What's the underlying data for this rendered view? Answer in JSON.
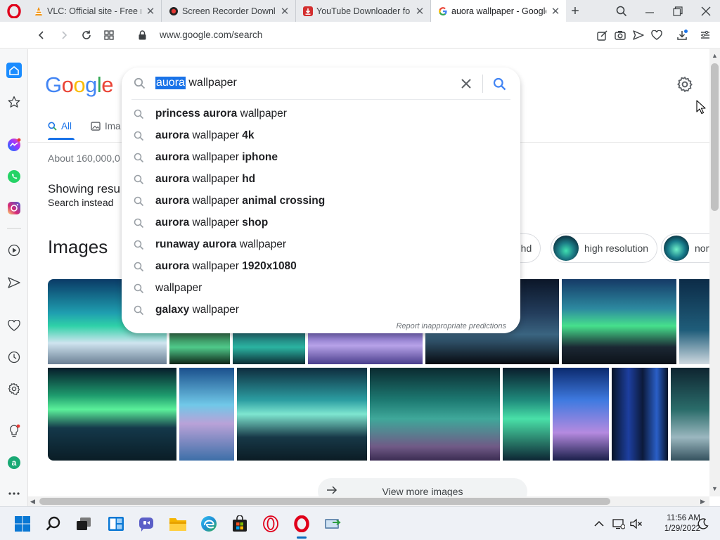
{
  "browser": {
    "tabs": [
      {
        "title": "VLC: Official site - Free m",
        "icon": "vlc-cone-icon",
        "active": false
      },
      {
        "title": "Screen Recorder Downlo",
        "icon": "record-dot-icon",
        "active": false
      },
      {
        "title": "YouTube Downloader for",
        "icon": "download-badge-icon",
        "active": false
      },
      {
        "title": "auora wallpaper - Google",
        "icon": "google-g-icon",
        "active": true
      }
    ],
    "new_tab_symbol": "+",
    "url": "www.google.com/search"
  },
  "google": {
    "logo_letters": [
      "G",
      "o",
      "o",
      "g",
      "l",
      "e"
    ],
    "logo_colors": [
      "#4285F4",
      "#EA4335",
      "#FBBC05",
      "#4285F4",
      "#34A853",
      "#EA4335"
    ],
    "tab_all": "All",
    "tab_images": "Ima",
    "stats": "About 160,000,0",
    "showing": "Showing resu",
    "search_instead": "Search instead",
    "images_heading": "Images",
    "chips": [
      {
        "label": "a hd"
      },
      {
        "label": "high resolution"
      },
      {
        "label": "nort"
      }
    ],
    "view_more": "View more images"
  },
  "search": {
    "query_selected": "auora",
    "query_rest": " wallpaper",
    "suggestions": [
      {
        "parts": [
          {
            "t": "princess aurora",
            "b": true
          },
          {
            "t": " wallpaper",
            "b": false
          }
        ]
      },
      {
        "parts": [
          {
            "t": "aurora",
            "b": true
          },
          {
            "t": " wallpaper ",
            "b": false
          },
          {
            "t": "4k",
            "b": true
          }
        ]
      },
      {
        "parts": [
          {
            "t": "aurora",
            "b": true
          },
          {
            "t": " wallpaper ",
            "b": false
          },
          {
            "t": "iphone",
            "b": true
          }
        ]
      },
      {
        "parts": [
          {
            "t": "aurora",
            "b": true
          },
          {
            "t": " wallpaper ",
            "b": false
          },
          {
            "t": "hd",
            "b": true
          }
        ]
      },
      {
        "parts": [
          {
            "t": "aurora",
            "b": true
          },
          {
            "t": " wallpaper ",
            "b": false
          },
          {
            "t": "animal crossing",
            "b": true
          }
        ]
      },
      {
        "parts": [
          {
            "t": "aurora",
            "b": true
          },
          {
            "t": " wallpaper ",
            "b": false
          },
          {
            "t": "shop",
            "b": true
          }
        ]
      },
      {
        "parts": [
          {
            "t": "runaway aurora",
            "b": true
          },
          {
            "t": " wallpaper",
            "b": false
          }
        ]
      },
      {
        "parts": [
          {
            "t": "aurora",
            "b": true
          },
          {
            "t": " wallpaper ",
            "b": false
          },
          {
            "t": "1920x1080",
            "b": true
          }
        ]
      },
      {
        "parts": [
          {
            "t": "wallpaper",
            "b": false
          }
        ]
      },
      {
        "parts": [
          {
            "t": "galaxy",
            "b": true
          },
          {
            "t": " wallpaper",
            "b": false
          }
        ]
      }
    ],
    "report": "Report inappropriate predictions"
  },
  "taskbar": {
    "time": "11:56 AM",
    "date": "1/29/2022"
  },
  "colors": {
    "google_blue": "#1a73e8",
    "opera_red": "#e0001a"
  }
}
